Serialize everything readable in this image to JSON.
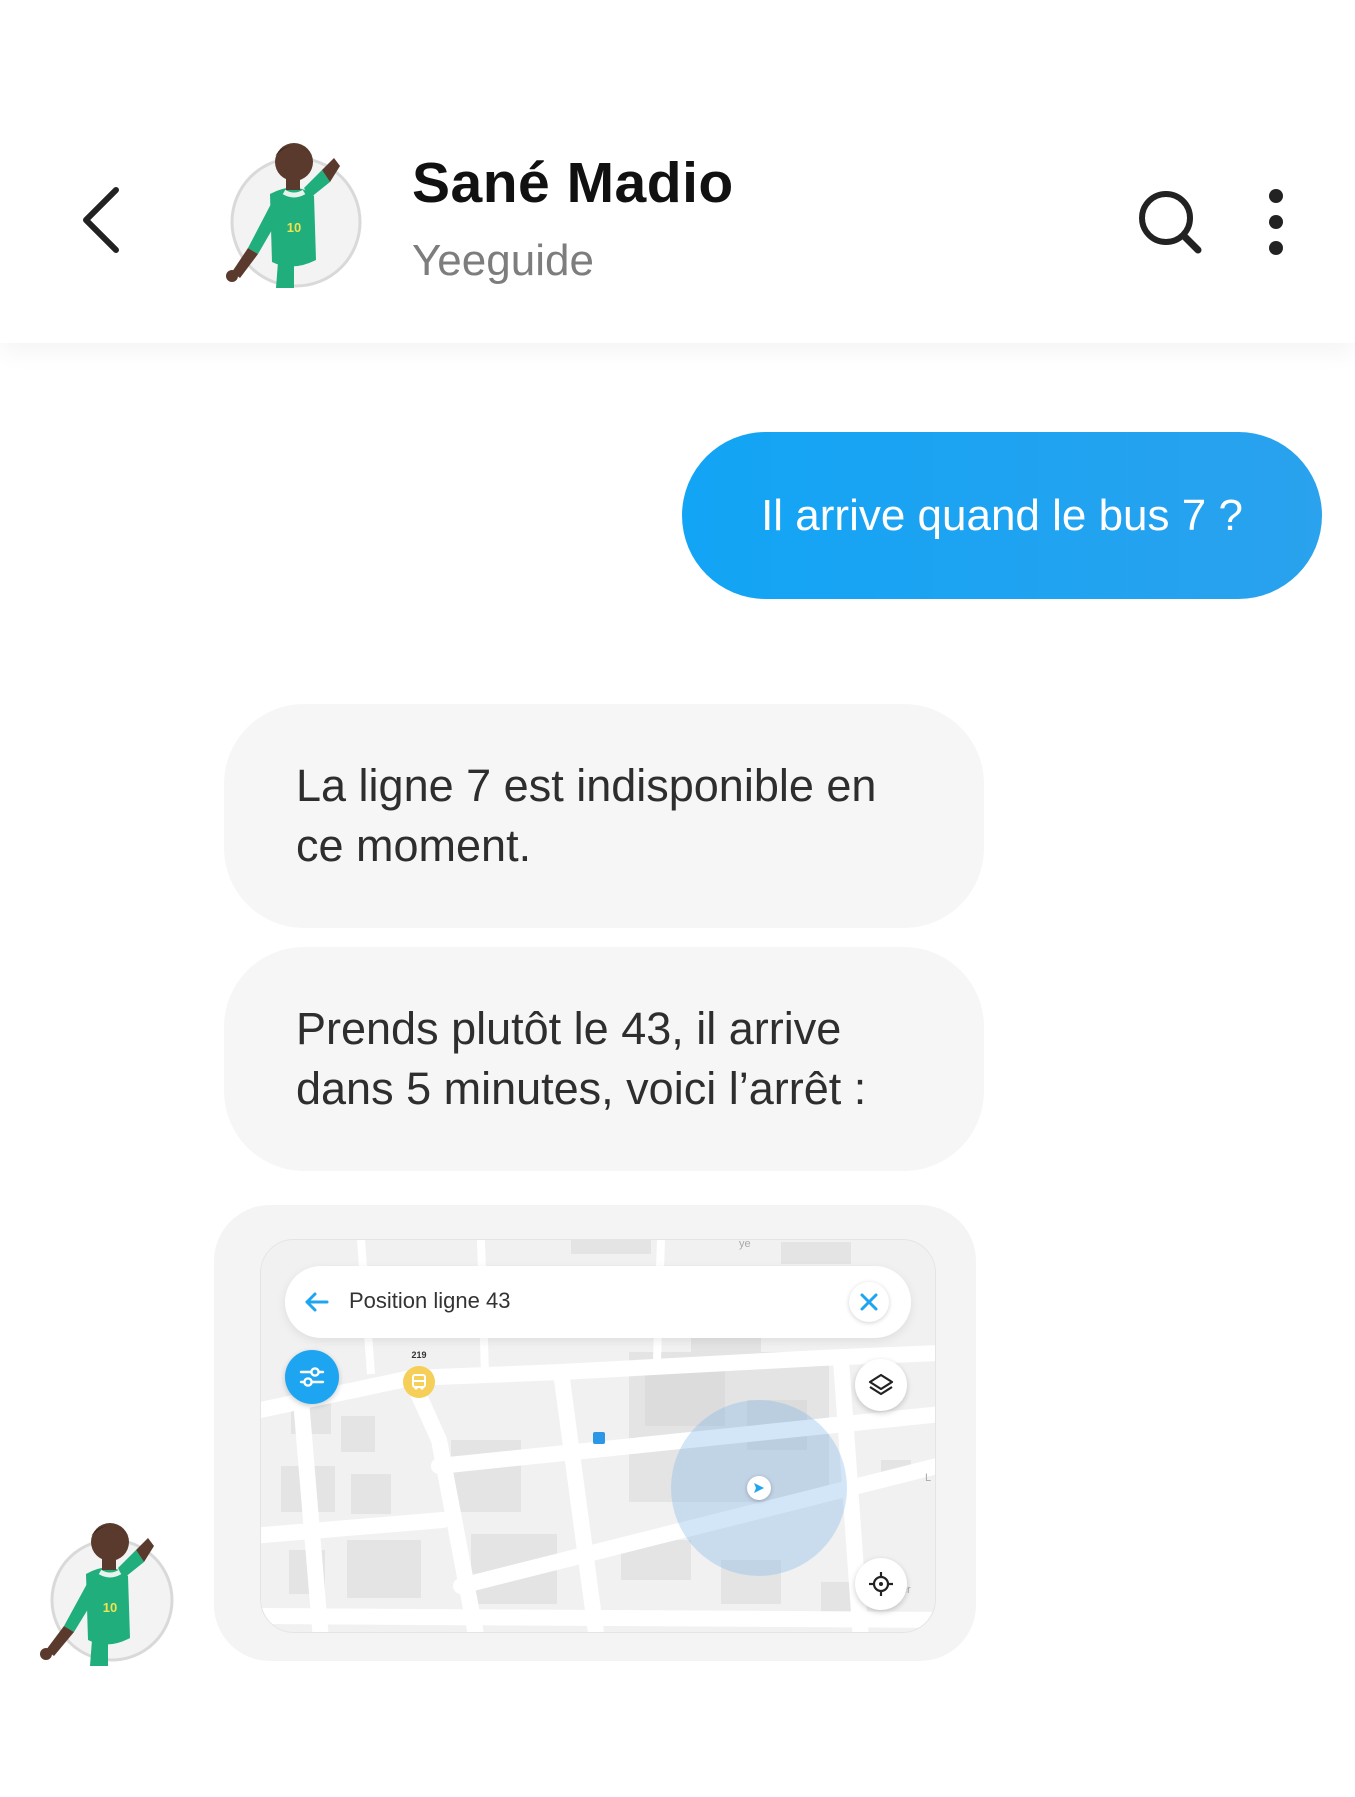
{
  "header": {
    "contact_name": "Sané Madio",
    "contact_subtitle": "Yeeguide",
    "icons": [
      "chevron-left-icon",
      "search-icon",
      "more-vertical-icon"
    ]
  },
  "messages": {
    "outgoing": [
      {
        "text": "Il arrive quand le bus 7 ?"
      }
    ],
    "incoming": [
      {
        "text": "La ligne 7 est indisponible en ce moment."
      },
      {
        "text": "Prends plutôt le 43, il arrive dans 5 minutes, voici l’arrêt :"
      }
    ]
  },
  "map": {
    "search_text": "Position ligne 43",
    "bus_stop_number": "219",
    "labels": [
      "ye",
      "L",
      "iiter"
    ],
    "icons": [
      "arrow-left-icon",
      "close-icon",
      "filter-icon",
      "layers-icon",
      "crosshair-icon",
      "bus-icon",
      "navigation-arrow-icon"
    ]
  },
  "colors": {
    "accent": "#1ea5f1",
    "bubble_incoming": "#f6f6f6",
    "bus_stop": "#f5cf57",
    "jersey": "#19b07a"
  }
}
